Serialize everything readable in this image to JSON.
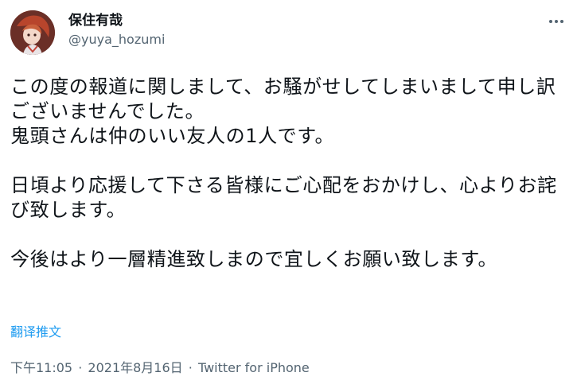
{
  "user": {
    "display_name": "保住有哉",
    "handle": "@yuya_hozumi"
  },
  "tweet": {
    "text": "この度の報道に関しまして、お騒がせしてしまいまして申し訳ございませんでした。\n鬼頭さんは仲のいい友人の1人です。\n\n日頃より応援して下さる皆様にご心配をおかけし、心よりお詫び致します。\n\n今後はより一層精進致しまので宜しくお願い致します。",
    "translate_label": "翻译推文"
  },
  "meta": {
    "time": "下午11:05",
    "separator": "·",
    "date": "2021年8月16日",
    "source": "Twitter for iPhone"
  },
  "icons": {
    "more": "more-horizontal-icon",
    "avatar": "avatar"
  },
  "colors": {
    "link": "#1d9bf0",
    "secondary_text": "#536471",
    "primary_text": "#0f1419"
  }
}
